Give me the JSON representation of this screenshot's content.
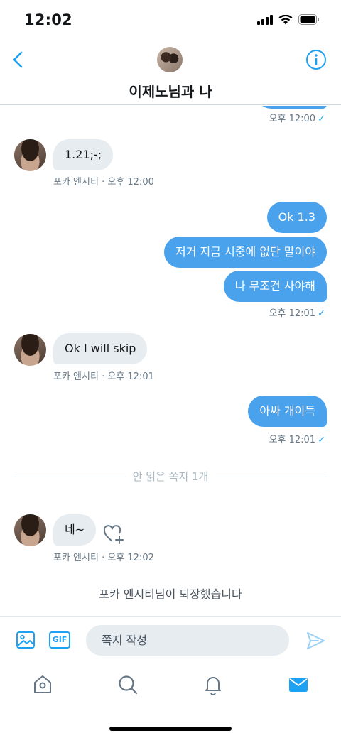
{
  "status_bar": {
    "time": "12:02"
  },
  "header": {
    "title": "이제노님과 나"
  },
  "messages": [
    {
      "direction": "out",
      "meta": "오후 12:00"
    },
    {
      "direction": "in",
      "text": "1.21;-;",
      "sender": "포카 엔시티",
      "time": "· 오후 12:00"
    },
    {
      "direction": "out",
      "text": "Ok 1.3"
    },
    {
      "direction": "out",
      "text": "저거 지금 시중에 없단 말이야"
    },
    {
      "direction": "out",
      "text": "나 무조건 사야해",
      "meta": "오후 12:01"
    },
    {
      "direction": "in",
      "text": "Ok I will skip",
      "sender": "포카 엔시티",
      "time": "· 오후 12:01"
    },
    {
      "direction": "out",
      "text": "아싸 개이득",
      "meta": "오후 12:01"
    },
    {
      "direction": "in",
      "text": "네~",
      "sender": "포카 엔시티",
      "time": "· 오후 12:02"
    }
  ],
  "unread_divider": "안 읽은 쪽지 1개",
  "system_note": "포카 엔시티님이 퇴장했습니다",
  "composer": {
    "placeholder": "쪽지 작성",
    "gif_label": "GIF"
  },
  "colors": {
    "accent": "#1da1f2",
    "bubble_out": "#4aa1ec",
    "bubble_in": "#e6ecf0",
    "meta": "#657786"
  },
  "icons": {
    "back": "chevron-left-icon",
    "info": "info-icon",
    "media": "image-icon",
    "send": "send-icon",
    "tabs": [
      "home-icon",
      "search-icon",
      "bell-icon",
      "mail-icon"
    ],
    "react": "heart-plus-icon"
  }
}
